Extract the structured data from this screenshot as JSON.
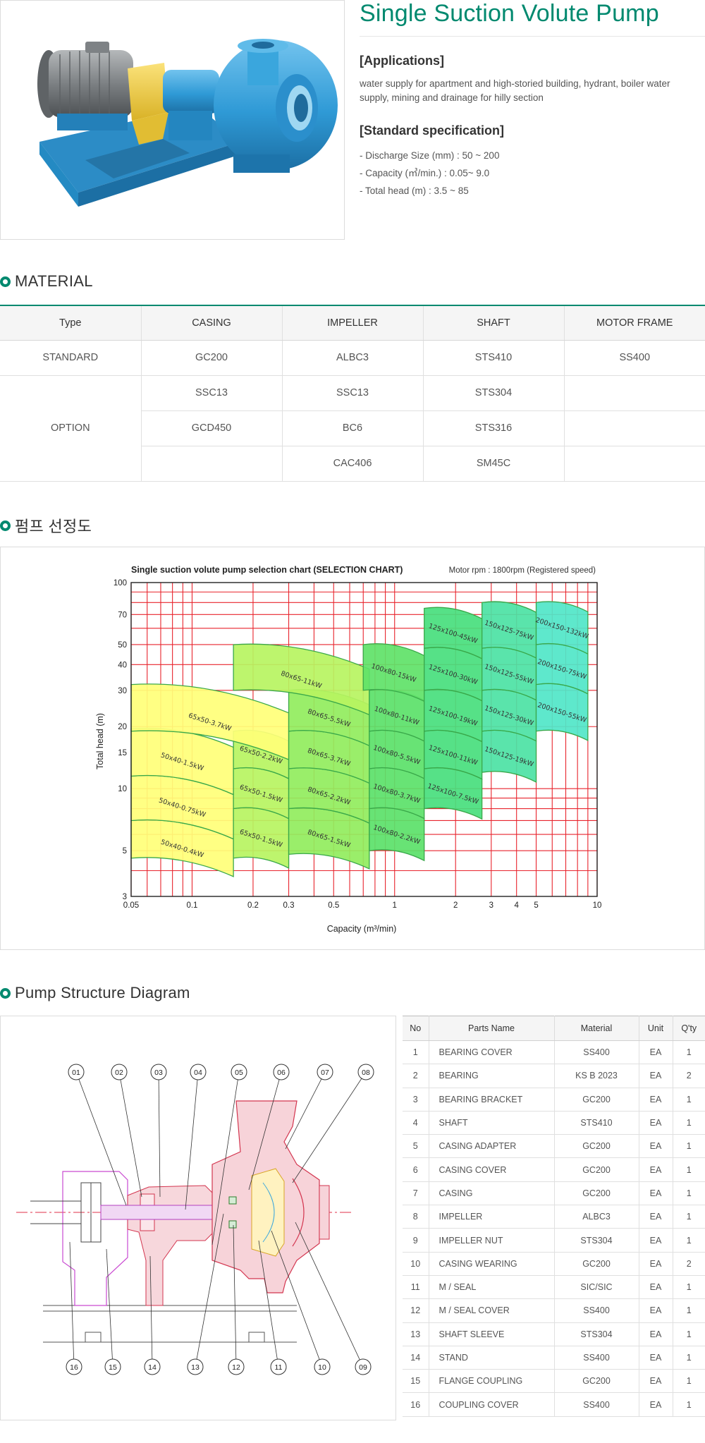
{
  "product": {
    "title": "Single Suction Volute Pump",
    "applications_heading": "[Applications]",
    "applications_text": "water supply for apartment and high-storied building, hydrant, boiler water supply, mining and drainage for hilly section",
    "spec_heading": "[Standard specification]",
    "specs": [
      "- Discharge Size (mm) : 50 ~ 200",
      "- Capacity (㎥/min.) : 0.05~ 9.0",
      "- Total head (m) : 3.5 ~ 85"
    ],
    "colors": {
      "accent": "#00896f",
      "pump_body": "#3aa6dd",
      "coupling_guard": "#f1d34a",
      "motor": "#8a8d8f"
    }
  },
  "material": {
    "section_title": "MATERIAL",
    "headers": [
      "Type",
      "CASING",
      "IMPELLER",
      "SHAFT",
      "MOTOR FRAME"
    ],
    "standard": {
      "type": "STANDARD",
      "casing": "GC200",
      "impeller": "ALBC3",
      "shaft": "STS410",
      "motor_frame": "SS400"
    },
    "option": {
      "type": "OPTION",
      "casing": [
        "SSC13",
        "GCD450",
        ""
      ],
      "impeller": [
        "SSC13",
        "BC6",
        "CAC406"
      ],
      "shaft": [
        "STS304",
        "STS316",
        "SM45C"
      ],
      "motor_frame": [
        "",
        "",
        ""
      ]
    }
  },
  "selection": {
    "section_title": "펌프 선정도"
  },
  "chart_data": {
    "type": "area",
    "title": "Single suction volute pump selection chart (SELECTION CHART)",
    "subtitle": "Motor rpm : 1800rpm (Registered speed)",
    "xlabel": "Capacity (m³/min)",
    "ylabel": "Total head (m)",
    "x_scale": "log",
    "y_scale": "log",
    "xlim": [
      0.05,
      10
    ],
    "ylim": [
      3,
      100
    ],
    "grid": true,
    "x_tick_labels": [
      "0.05",
      "0.1",
      "0.2",
      "0.3",
      "0.5",
      "1",
      "2",
      "3",
      "4",
      "5",
      "10"
    ],
    "y_tick_labels": [
      "3",
      "5",
      "10",
      "15",
      "20",
      "30",
      "40",
      "50",
      "70",
      "100"
    ],
    "series": [
      {
        "label": "50x40-0.4kW",
        "q": [
          0.05,
          0.16
        ],
        "h": [
          4.6,
          7.0
        ]
      },
      {
        "label": "50x40-0.75kW",
        "q": [
          0.05,
          0.16
        ],
        "h": [
          7.0,
          11.5
        ]
      },
      {
        "label": "50x40-1.5kW",
        "q": [
          0.05,
          0.16
        ],
        "h": [
          11.5,
          19.5
        ]
      },
      {
        "label": "65x50-1.5kW",
        "q": [
          0.16,
          0.3
        ],
        "h": [
          4.6,
          8.0
        ]
      },
      {
        "label": "65x50-1.5kW",
        "q": [
          0.16,
          0.3
        ],
        "h": [
          8.0,
          12.5
        ]
      },
      {
        "label": "65x50-2.2kW",
        "q": [
          0.16,
          0.3
        ],
        "h": [
          12.5,
          19.0
        ]
      },
      {
        "label": "65x50-3.7kW",
        "q": [
          0.05,
          0.3
        ],
        "h": [
          19.0,
          32.0
        ]
      },
      {
        "label": "80x65-1.5kW",
        "q": [
          0.3,
          0.75
        ],
        "h": [
          4.8,
          8.0
        ]
      },
      {
        "label": "80x65-2.2kW",
        "q": [
          0.3,
          0.75
        ],
        "h": [
          8.0,
          12.5
        ]
      },
      {
        "label": "80x65-3.7kW",
        "q": [
          0.3,
          0.75
        ],
        "h": [
          12.5,
          19.0
        ]
      },
      {
        "label": "80x65-5.5kW",
        "q": [
          0.3,
          0.75
        ],
        "h": [
          19.0,
          30.0
        ]
      },
      {
        "label": "80x65-11kW",
        "q": [
          0.16,
          0.75
        ],
        "h": [
          30.0,
          50.0
        ]
      },
      {
        "label": "100x80-2.2kW",
        "q": [
          0.75,
          1.4
        ],
        "h": [
          5.0,
          8.0
        ]
      },
      {
        "label": "100x80-3.7kW",
        "q": [
          0.75,
          1.4
        ],
        "h": [
          8.0,
          12.5
        ]
      },
      {
        "label": "100x80-5.5kW",
        "q": [
          0.75,
          1.4
        ],
        "h": [
          12.5,
          19.0
        ]
      },
      {
        "label": "100x80-11kW",
        "q": [
          0.75,
          1.4
        ],
        "h": [
          19.0,
          30.0
        ]
      },
      {
        "label": "100x80-15kW",
        "q": [
          0.7,
          1.4
        ],
        "h": [
          30.0,
          50.0
        ]
      },
      {
        "label": "125x100-7.5kW",
        "q": [
          1.4,
          2.7
        ],
        "h": [
          8.0,
          12.5
        ]
      },
      {
        "label": "125x100-11kW",
        "q": [
          1.4,
          2.7
        ],
        "h": [
          12.5,
          19.0
        ]
      },
      {
        "label": "125x100-19kW",
        "q": [
          1.4,
          2.7
        ],
        "h": [
          19.0,
          30.0
        ]
      },
      {
        "label": "125x100-30kW",
        "q": [
          1.4,
          2.7
        ],
        "h": [
          30.0,
          48.0
        ]
      },
      {
        "label": "125x100-45kW",
        "q": [
          1.4,
          2.7
        ],
        "h": [
          48.0,
          75.0
        ]
      },
      {
        "label": "150x125-19kW",
        "q": [
          2.7,
          5.0
        ],
        "h": [
          12.0,
          19.0
        ]
      },
      {
        "label": "150x125-30kW",
        "q": [
          2.7,
          5.0
        ],
        "h": [
          19.0,
          30.0
        ]
      },
      {
        "label": "150x125-55kW",
        "q": [
          2.7,
          5.0
        ],
        "h": [
          30.0,
          48.0
        ]
      },
      {
        "label": "150x125-75kW",
        "q": [
          2.7,
          5.0
        ],
        "h": [
          48.0,
          80.0
        ]
      },
      {
        "label": "200x150-55kW",
        "q": [
          5.0,
          9.0
        ],
        "h": [
          19.0,
          32.0
        ]
      },
      {
        "label": "200x150-75kW",
        "q": [
          5.0,
          9.0
        ],
        "h": [
          32.0,
          50.0
        ]
      },
      {
        "label": "200x150-132kW",
        "q": [
          5.0,
          9.0
        ],
        "h": [
          50.0,
          80.0
        ]
      }
    ]
  },
  "structure": {
    "section_title": "Pump Structure Diagram",
    "callouts_top": [
      "01",
      "02",
      "03",
      "04",
      "05",
      "06",
      "07",
      "08"
    ],
    "callouts_bottom": [
      "16",
      "15",
      "14",
      "13",
      "12",
      "11",
      "10",
      "09"
    ],
    "parts_headers": [
      "No",
      "Parts Name",
      "Material",
      "Unit",
      "Q'ty"
    ],
    "parts": [
      {
        "no": "1",
        "name": "BEARING COVER",
        "material": "SS400",
        "unit": "EA",
        "qty": "1"
      },
      {
        "no": "2",
        "name": "BEARING",
        "material": "KS B 2023",
        "unit": "EA",
        "qty": "2"
      },
      {
        "no": "3",
        "name": "BEARING BRACKET",
        "material": "GC200",
        "unit": "EA",
        "qty": "1"
      },
      {
        "no": "4",
        "name": "SHAFT",
        "material": "STS410",
        "unit": "EA",
        "qty": "1"
      },
      {
        "no": "5",
        "name": "CASING ADAPTER",
        "material": "GC200",
        "unit": "EA",
        "qty": "1"
      },
      {
        "no": "6",
        "name": "CASING COVER",
        "material": "GC200",
        "unit": "EA",
        "qty": "1"
      },
      {
        "no": "7",
        "name": "CASING",
        "material": "GC200",
        "unit": "EA",
        "qty": "1"
      },
      {
        "no": "8",
        "name": "IMPELLER",
        "material": "ALBC3",
        "unit": "EA",
        "qty": "1"
      },
      {
        "no": "9",
        "name": "IMPELLER NUT",
        "material": "STS304",
        "unit": "EA",
        "qty": "1"
      },
      {
        "no": "10",
        "name": "CASING WEARING",
        "material": "GC200",
        "unit": "EA",
        "qty": "2"
      },
      {
        "no": "11",
        "name": "M / SEAL",
        "material": "SIC/SIC",
        "unit": "EA",
        "qty": "1"
      },
      {
        "no": "12",
        "name": "M / SEAL COVER",
        "material": "SS400",
        "unit": "EA",
        "qty": "1"
      },
      {
        "no": "13",
        "name": "SHAFT SLEEVE",
        "material": "STS304",
        "unit": "EA",
        "qty": "1"
      },
      {
        "no": "14",
        "name": "STAND",
        "material": "SS400",
        "unit": "EA",
        "qty": "1"
      },
      {
        "no": "15",
        "name": "FLANGE COUPLING",
        "material": "GC200",
        "unit": "EA",
        "qty": "1"
      },
      {
        "no": "16",
        "name": "COUPLING COVER",
        "material": "SS400",
        "unit": "EA",
        "qty": "1"
      }
    ]
  }
}
